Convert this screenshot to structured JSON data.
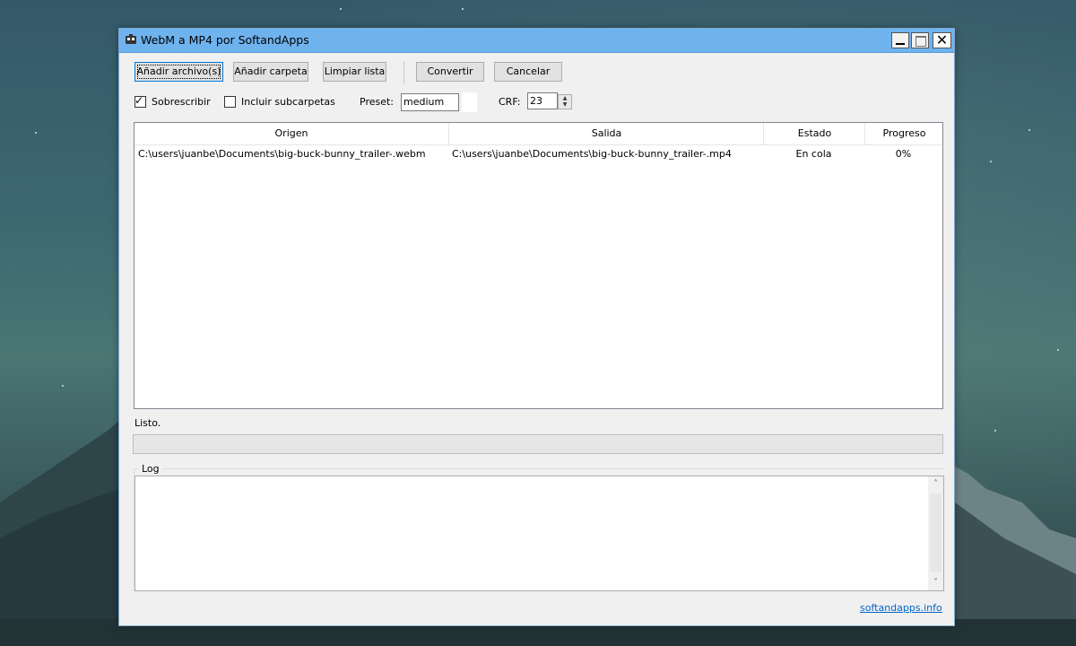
{
  "window": {
    "title": "WebM a MP4 por SoftandApps",
    "close_glyph": "✕"
  },
  "toolbar": {
    "add_files": "Añadir archivo(s)",
    "add_folder": "Añadir carpeta",
    "clear_list": "Limpiar lista",
    "convert": "Convertir",
    "cancel": "Cancelar"
  },
  "options": {
    "overwrite_label": "Sobrescribir",
    "overwrite_checked": true,
    "include_subfolders_label": "Incluir subcarpetas",
    "include_subfolders_checked": false,
    "preset_label": "Preset:",
    "preset_value": "medium",
    "crf_label": "CRF:",
    "crf_value": "23"
  },
  "table": {
    "columns": [
      "Origen",
      "Salida",
      "Estado",
      "Progreso"
    ],
    "rows": [
      {
        "origin": "C:\\users\\juanbe\\Documents\\big-buck-bunny_trailer-.webm",
        "output": "C:\\users\\juanbe\\Documents\\big-buck-bunny_trailer-.mp4",
        "status": "En cola",
        "progress": "0%"
      }
    ]
  },
  "status": {
    "text": "Listo.",
    "progress_fraction": 0
  },
  "log": {
    "label": "Log",
    "content": ""
  },
  "footer": {
    "link": "softandapps.info"
  },
  "icons": {
    "app": "app-icon",
    "minimize": "minimize-icon",
    "maximize": "maximize-icon",
    "close": "close-icon",
    "check": "checkmark-icon",
    "scroll_up": "chevron-up-icon",
    "scroll_down": "chevron-down-icon"
  },
  "colors": {
    "titlebar": "#6fb3ee",
    "link": "#0066cc",
    "progress": "#06b025"
  }
}
